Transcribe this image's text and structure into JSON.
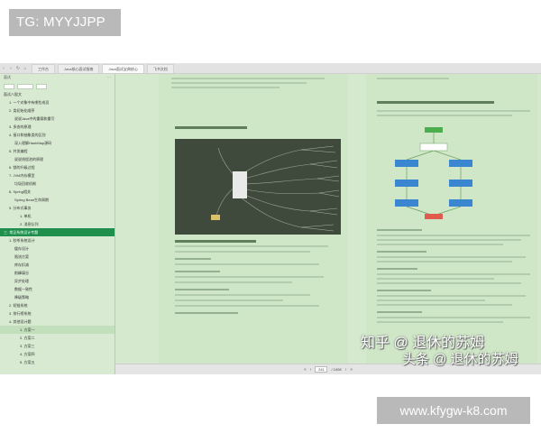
{
  "watermark_top": "TG: MYYJJPP",
  "watermark_bottom": "www.kfygw-k8.com",
  "overlay_line1": "知乎 @ 退休的苏姆",
  "overlay_line2": "头条 @ 退休的苏姆",
  "tabbar": {
    "tabs": [
      "工作台",
      "Java核心面试指南",
      "Java面试宝典核心",
      "飞书文档"
    ],
    "active_index": 2
  },
  "sidebar": {
    "header_left": "面试",
    "header_right": "···",
    "items": [
      {
        "label": "面试八股文",
        "level": 0
      },
      {
        "label": "1. 一个对象中有哪些成员",
        "level": 1
      },
      {
        "label": "2. 类初始化顺序",
        "level": 1
      },
      {
        "label": "说说Java中的重载和重写",
        "level": 2
      },
      {
        "label": "3. 多态的原理",
        "level": 1
      },
      {
        "label": "4. 接口和抽象类的区别",
        "level": 1
      },
      {
        "label": "深入理解HashMap源码",
        "level": 2
      },
      {
        "label": "5. 并发编程",
        "level": 1
      },
      {
        "label": "说说线程池的原理",
        "level": 2
      },
      {
        "label": "6. 锁的升级过程",
        "level": 1
      },
      {
        "label": "7. JVM内存模型",
        "level": 1
      },
      {
        "label": "垃圾回收机制",
        "level": 2
      },
      {
        "label": "8. Spring相关",
        "level": 1
      },
      {
        "label": "Spring Bean生命周期",
        "level": 2
      },
      {
        "label": "9. 分布式事务",
        "level": 1
      },
      {
        "label": "1. 单机",
        "level": 3
      },
      {
        "label": "2. 消息队列",
        "level": 3
      },
      {
        "label": "三. 常见系统设计专题",
        "level": 0,
        "active": true
      },
      {
        "label": "1. 秒杀系统设计",
        "level": 1
      },
      {
        "label": "缓存设计",
        "level": 2
      },
      {
        "label": "限流方案",
        "level": 2
      },
      {
        "label": "库存扣减",
        "level": 2
      },
      {
        "label": "削峰填谷",
        "level": 2
      },
      {
        "label": "异步处理",
        "level": 2
      },
      {
        "label": "数据一致性",
        "level": 2
      },
      {
        "label": "降级策略",
        "level": 2
      },
      {
        "label": "2. 短链系统",
        "level": 1
      },
      {
        "label": "3. 排行榜系统",
        "level": 1
      },
      {
        "label": "4. 其他设计题",
        "level": 1
      },
      {
        "label": "1. 方案一",
        "level": 3,
        "hl": true
      },
      {
        "label": "2. 方案二",
        "level": 3
      },
      {
        "label": "3. 方案三",
        "level": 3
      },
      {
        "label": "4. 方案四",
        "level": 3
      },
      {
        "label": "5. 方案五",
        "level": 3
      }
    ]
  },
  "page_nav": {
    "current": "241",
    "total": "/ 1008"
  },
  "colors": {
    "sidebar_bg": "#d8ead2",
    "active_item": "#1f8f4e",
    "page_bg": "#cfe7c7",
    "mindmap_bg": "#3f4a3d"
  }
}
